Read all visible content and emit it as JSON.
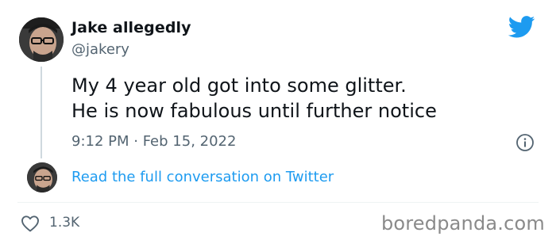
{
  "author": {
    "name": "Jake allegedly",
    "handle": "@jakery"
  },
  "tweet": {
    "lines": [
      "My 4 year old got into some glitter.",
      "He is now fabulous until further notice"
    ],
    "time": "9:12 PM · Feb 15, 2022",
    "likes": "1.3K"
  },
  "conversation": {
    "link_label": "Read the full conversation on Twitter"
  },
  "watermark": "boredpanda.com",
  "colors": {
    "twitter_blue": "#1d9bf0",
    "secondary_text": "#536471",
    "primary_text": "#0f1419"
  },
  "icons": {
    "logo": "twitter-bird-icon",
    "info": "info-icon",
    "like": "heart-icon"
  }
}
